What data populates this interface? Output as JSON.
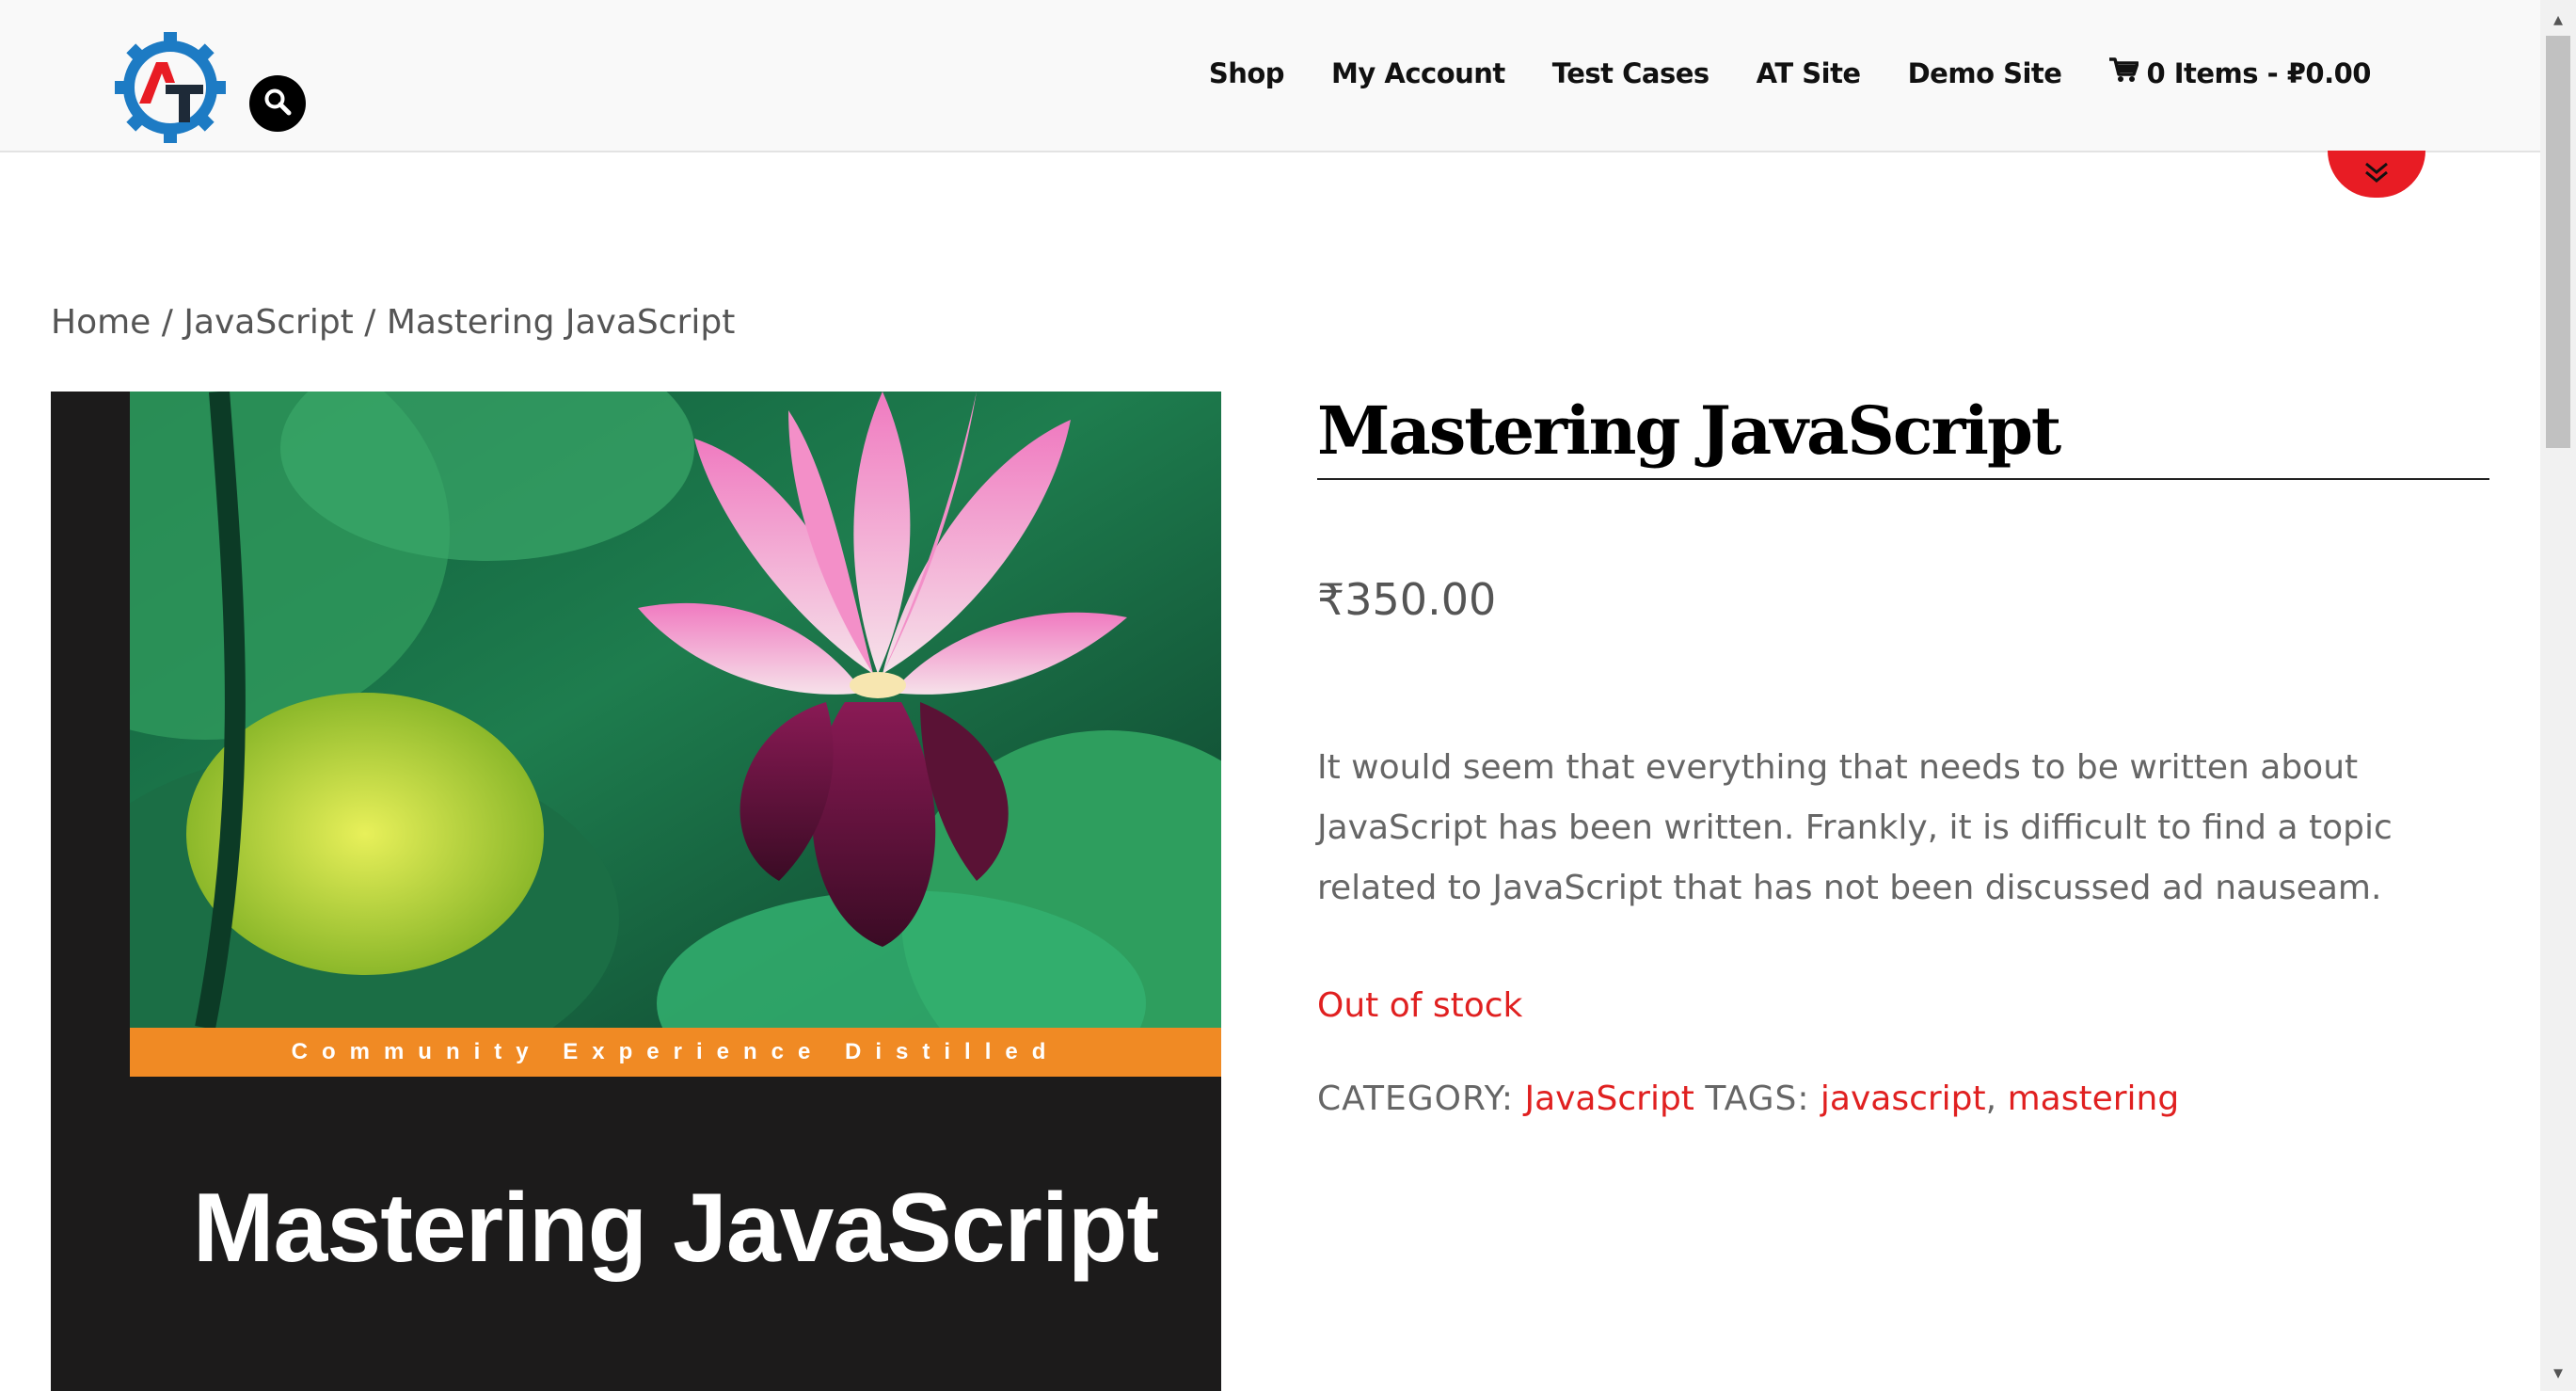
{
  "header": {
    "logo_letters": "AT",
    "nav": [
      {
        "label": "Shop"
      },
      {
        "label": "My Account"
      },
      {
        "label": "Test Cases"
      },
      {
        "label": "AT Site"
      },
      {
        "label": "Demo Site"
      }
    ],
    "cart_label": "0 Items - ₽0.00"
  },
  "breadcrumb": {
    "home": "Home",
    "sep1": " / ",
    "category": "JavaScript",
    "sep2": " / ",
    "current": "Mastering JavaScript"
  },
  "product": {
    "cover": {
      "tagline": "Community Experience Distilled",
      "title": "Mastering JavaScript"
    },
    "title": "Mastering JavaScript",
    "price": "₹350.00",
    "description": "It would seem that everything that needs to be written about JavaScript has been written. Frankly, it is difficult to find a topic related to JavaScript that has not been discussed ad nauseam.",
    "stock_status": "Out of stock",
    "category_label": "CATEGORY:",
    "category_value": "JavaScript",
    "tags_label": "TAGS:",
    "tags": [
      "javascript",
      "mastering"
    ],
    "tag_separator": ","
  },
  "colors": {
    "accent": "#e81c24",
    "link": "#e02020",
    "logo_blue": "#1d7bc4",
    "cover_band": "#f08a24"
  },
  "icons": [
    "search-icon",
    "cart-icon",
    "chevron-double-down-icon"
  ]
}
